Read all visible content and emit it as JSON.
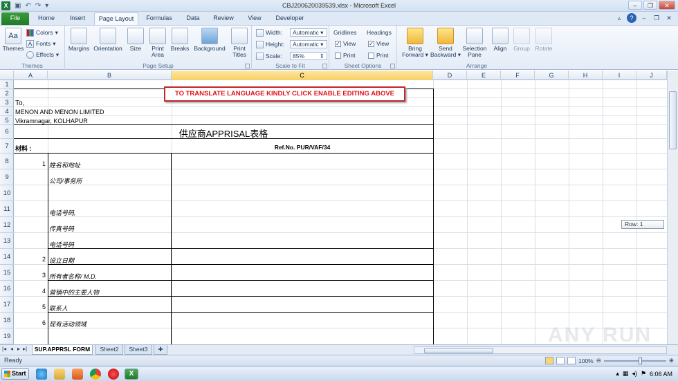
{
  "app": {
    "title": "CBJ200620039539.xlsx - Microsoft Excel",
    "logo": "X"
  },
  "quick_access": [
    "save",
    "undo",
    "redo",
    "customize"
  ],
  "tabs": [
    {
      "label": "File"
    },
    {
      "label": "Home"
    },
    {
      "label": "Insert"
    },
    {
      "label": "Page Layout"
    },
    {
      "label": "Formulas"
    },
    {
      "label": "Data"
    },
    {
      "label": "Review"
    },
    {
      "label": "View"
    },
    {
      "label": "Developer"
    }
  ],
  "ribbon": {
    "themes": {
      "group": "Themes",
      "themes": "Themes",
      "colors": "Colors",
      "fonts": "Fonts",
      "effects": "Effects"
    },
    "page_setup": {
      "group": "Page Setup",
      "margins": "Margins",
      "orientation": "Orientation",
      "size": "Size",
      "print_area_1": "Print",
      "print_area_2": "Area",
      "breaks": "Breaks",
      "background": "Background",
      "print_titles_1": "Print",
      "print_titles_2": "Titles"
    },
    "scale": {
      "group": "Scale to Fit",
      "width_label": "Width:",
      "width_value": "Automatic",
      "height_label": "Height:",
      "height_value": "Automatic",
      "scale_label": "Scale:",
      "scale_value": "85%"
    },
    "sheet_options": {
      "group": "Sheet Options",
      "gridlines": "Gridlines",
      "headings": "Headings",
      "view": "View",
      "print": "Print"
    },
    "arrange": {
      "group": "Arrange",
      "bring_1": "Bring",
      "bring_2": "Forward",
      "send_1": "Send",
      "send_2": "Backward",
      "selection_1": "Selection",
      "selection_2": "Pane",
      "align": "Align",
      "group_btn": "Group",
      "rotate": "Rotate"
    }
  },
  "columns": [
    "A",
    "B",
    "C",
    "D",
    "E",
    "F",
    "G",
    "H",
    "I",
    "J"
  ],
  "rows": [
    "1",
    "2",
    "3",
    "4",
    "5",
    "6",
    "7",
    "8",
    "9",
    "10",
    "11",
    "12",
    "13",
    "14",
    "15",
    "16",
    "17",
    "18",
    "19"
  ],
  "sheet": {
    "banner": "TO TRANSLATE LANGUAGE KINDLY CLICK ENABLE EDITING ABOVE",
    "to": "To,",
    "company": "MENON AND MENON LIMITED",
    "address": "Vikramnagar, KOLHAPUR",
    "title": "供应商APPRISAL表格",
    "material": "材料 :",
    "refno": "Ref.No. PUR/VAF/34",
    "items": [
      {
        "no": "1",
        "label": "姓名和地址"
      },
      {
        "no": "",
        "label": "公司/事务所"
      },
      {
        "no": "",
        "label": "电话号码,"
      },
      {
        "no": "",
        "label": "传真号码"
      },
      {
        "no": "",
        "label": "电话号码"
      },
      {
        "no": "2",
        "label": "设立日期"
      },
      {
        "no": "3",
        "label": "所有者名称/ M.D."
      },
      {
        "no": "4",
        "label": "营销中的主要人物"
      },
      {
        "no": "5",
        "label": "联系人"
      },
      {
        "no": "6",
        "label": "现有活动领域"
      }
    ],
    "row_tip": "Row: 1"
  },
  "sheet_tabs": [
    "SUP.APPRSL FORM",
    "Sheet2",
    "Sheet3"
  ],
  "status": {
    "ready": "Ready",
    "zoom": "100%"
  },
  "taskbar": {
    "start": "Start",
    "time": "6:06 AM"
  },
  "watermark": "ANY RUN"
}
